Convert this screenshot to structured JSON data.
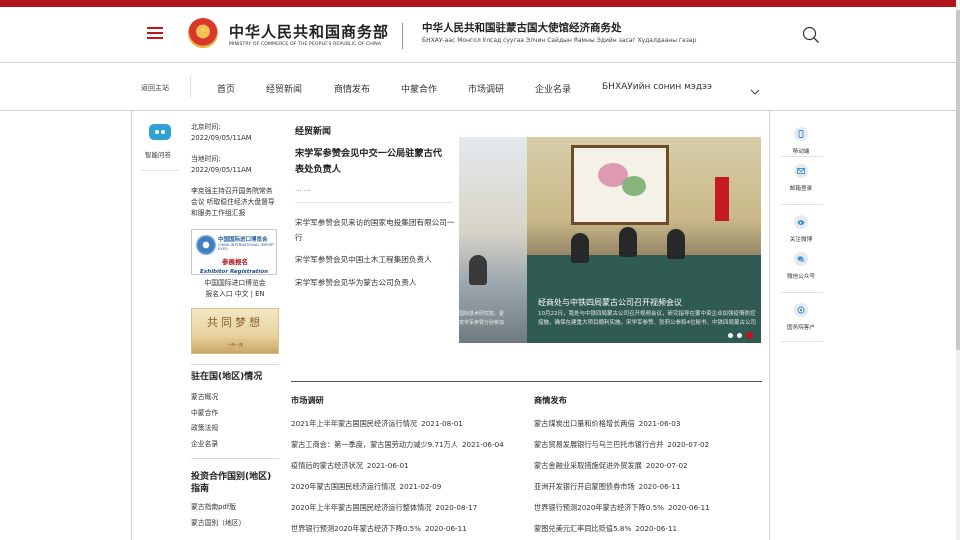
{
  "header": {
    "ministry_cn": "中华人民共和国商务部",
    "ministry_en": "MINISTRY OF COMMERCE OF THE PEOPLE'S REPUBLIC OF CHINA",
    "office_cn": "中华人民共和国驻蒙古国大使馆经济商务处",
    "office_mn": "БНХАУ-аас Монгол Улсад суугаа Элчин Сайдын Яамны Эдийн засаг Худалдааны газар"
  },
  "nav": {
    "back": "返回主站",
    "items": [
      "首页",
      "经贸新闻",
      "商情发布",
      "中蒙合作",
      "市场调研",
      "企业名录",
      "БНХАУийн сонин мэдээ"
    ]
  },
  "sidebar_left": {
    "bot_label": "智能问答"
  },
  "info": {
    "beijing_time_label": "北京时间:",
    "beijing_time": "2022/09/05/11AM",
    "local_time_label": "当地时间:",
    "local_time": "2022/09/05/11AM",
    "headline": "李克强主持召开国务院常务会议 听取稳住经济大盘督导和服务工作组汇报",
    "expo_cn": "中国国际进口博览会",
    "expo_en": "CHINA INTERNATIONAL IMPORT EXPO",
    "expo_reg": "参展报名",
    "expo_reg_en": "Exhibitor Registration",
    "expo_link_1": "中国国际进口博览会",
    "expo_link_2": "报名入口",
    "lang_cn": "中文",
    "lang_sep": "|",
    "lang_en": "EN",
    "dream_text": "共同梦想",
    "dream_sub": "一带一路",
    "region_title": "驻在国(地区)情况",
    "region_items": [
      "蒙古概况",
      "中蒙合作",
      "政策法规",
      "企业名录"
    ],
    "guide_title": "投资合作国别(地区)指南",
    "guide_items": [
      "蒙古指南pdf版",
      "蒙古国别（地区）"
    ]
  },
  "news": {
    "section": "经贸新闻",
    "top_title": "宋学军参赞会见中交一公局驻蒙古代表处负责人",
    "ellipsis": "... ...",
    "items": [
      "宋学军参赞会见来访的国家电投集团有限公司一行",
      "宋学军参赞会见中国土木工程集团负责人",
      "宋学军参赞会见华为蒙古公司负责人"
    ]
  },
  "slideshow": {
    "caption": "经商处与中铁四局蒙古公司召开视频会议",
    "desc": "10月22日，我处与中铁四局蒙古公司召开视频会议，研究指导在蒙中资企业加强疫情防控",
    "desc2": "措施，确保在建重大项目顺利实施。宋学军参赞、张莉公参和4位秘书、中铁四局蒙古公司",
    "side_text_1": "国际技术研究院、蒙",
    "side_text_2": "宋学军参赞分别参加"
  },
  "market": {
    "title": "市场调研",
    "items": [
      {
        "text": "2021年上半年蒙古国国民经济运行情况",
        "date": "2021-08-01"
      },
      {
        "text": "蒙古工商会：第一季度，蒙古国劳动力减少9.71万人",
        "date": "2021-06-04"
      },
      {
        "text": "疫情后的蒙古经济状况",
        "date": "2021-06-01"
      },
      {
        "text": "2020年蒙古国国民经济运行情况",
        "date": "2021-02-09"
      },
      {
        "text": "2020年上半年蒙古国国民经济运行整体情况",
        "date": "2020-08-17"
      },
      {
        "text": "世界银行预测2020年蒙古经济下降0.5%",
        "date": "2020-06-11"
      }
    ]
  },
  "business": {
    "title": "商情发布",
    "items": [
      {
        "text": "蒙古煤炭出口量和价格增长两倍",
        "date": "2021-06-03"
      },
      {
        "text": "蒙古贸易发展银行与乌兰巴托市银行合并",
        "date": "2020-07-02"
      },
      {
        "text": "蒙古金融业采取措施促进外贸发展",
        "date": "2020-07-02"
      },
      {
        "text": "亚洲开发银行开启蒙图债券市场",
        "date": "2020-06-11"
      },
      {
        "text": "世界银行预测2020年蒙古经济下降0.5%",
        "date": "2020-06-11"
      },
      {
        "text": "蒙图兑美元汇率同比贬值5.8%",
        "date": "2020-06-11"
      }
    ]
  },
  "share": {
    "items": [
      "移动端",
      "邮箱登录",
      "关注微博",
      "微信公众号",
      "国务院客户"
    ]
  },
  "colors": {
    "brand_red": "#b3151c",
    "bot_blue": "#2fa2d3"
  }
}
